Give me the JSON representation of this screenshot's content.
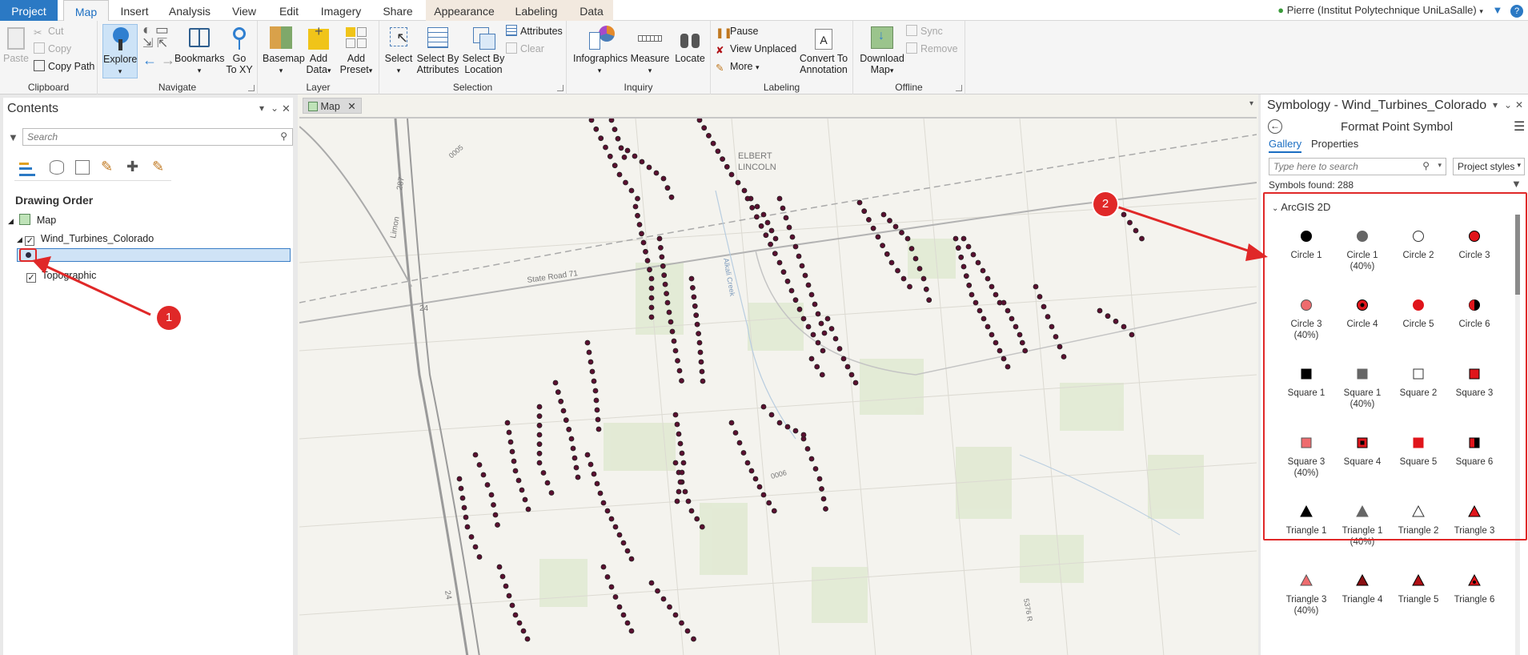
{
  "tabs": {
    "project": "Project",
    "map": "Map",
    "insert": "Insert",
    "analysis": "Analysis",
    "view": "View",
    "edit": "Edit",
    "imagery": "Imagery",
    "share": "Share",
    "appearance": "Appearance",
    "labeling": "Labeling",
    "data": "Data"
  },
  "user": "Pierre (Institut Polytechnique UniLaSalle)",
  "ribbon": {
    "clipboard": {
      "label": "Clipboard",
      "paste": "Paste",
      "cut": "Cut",
      "copy": "Copy",
      "copy_path": "Copy Path"
    },
    "navigate": {
      "label": "Navigate",
      "explore": "Explore",
      "bookmarks": "Bookmarks",
      "goto": "Go",
      "goto2": "To XY"
    },
    "layer": {
      "label": "Layer",
      "basemap": "Basemap",
      "add_data": "Add",
      "add_data2": "Data",
      "add_preset": "Add",
      "add_preset2": "Preset"
    },
    "selection": {
      "label": "Selection",
      "select": "Select",
      "sel_attr": "Select By",
      "sel_attr2": "Attributes",
      "sel_loc": "Select By",
      "sel_loc2": "Location",
      "attributes": "Attributes",
      "clear": "Clear"
    },
    "inquiry": {
      "label": "Inquiry",
      "infographics": "Infographics",
      "measure": "Measure",
      "locate": "Locate"
    },
    "labeling": {
      "label": "Labeling",
      "pause": "Pause",
      "view_unplaced": "View Unplaced",
      "more": "More",
      "convert": "Convert To",
      "convert2": "Annotation"
    },
    "offline": {
      "label": "Offline",
      "download": "Download",
      "download2": "Map",
      "sync": "Sync",
      "remove": "Remove"
    }
  },
  "contents": {
    "title": "Contents",
    "search_placeholder": "Search",
    "drawing_order": "Drawing Order",
    "map_name": "Map",
    "layer1": "Wind_Turbines_Colorado",
    "layer2": "Topographic"
  },
  "map": {
    "tab": "Map",
    "labels": {
      "elbert": "ELBERT",
      "lincoln": "LINCOLN",
      "state_road": "State Road 71",
      "limon": "Limon",
      "road287": "287",
      "road24": "24",
      "road0005": "0005",
      "road0006": "0006",
      "road24b": "24",
      "road5376": "5376 R",
      "alkali": "Alkali Creek"
    }
  },
  "symbology": {
    "title": "Symbology - Wind_Turbines_Colorado",
    "subtitle": "Format Point Symbol",
    "tab_gallery": "Gallery",
    "tab_properties": "Properties",
    "search_placeholder": "Type here to search",
    "styles": "Project styles",
    "found": "Symbols found: 288",
    "category": "ArcGIS 2D",
    "items": [
      {
        "name": "Circle 1",
        "sub": "",
        "shape": "circle",
        "fill": "#000000",
        "stroke": "#000000"
      },
      {
        "name": "Circle 1",
        "sub": "(40%)",
        "shape": "circle",
        "fill": "#666666",
        "stroke": "#666666"
      },
      {
        "name": "Circle 2",
        "sub": "",
        "shape": "circle",
        "fill": "#ffffff",
        "stroke": "#333333"
      },
      {
        "name": "Circle 3",
        "sub": "",
        "shape": "circle",
        "fill": "#e0151b",
        "stroke": "#000000"
      },
      {
        "name": "Circle 3",
        "sub": "(40%)",
        "shape": "circle",
        "fill": "#ee6b6e",
        "stroke": "#555555"
      },
      {
        "name": "Circle 4",
        "sub": "",
        "shape": "circle-dot",
        "fill": "#e0151b",
        "stroke": "#000000"
      },
      {
        "name": "Circle 5",
        "sub": "",
        "shape": "circle",
        "fill": "#e0151b",
        "stroke": "#e0151b"
      },
      {
        "name": "Circle 6",
        "sub": "",
        "shape": "circle-half",
        "fill": "#e0151b",
        "stroke": "#000000"
      },
      {
        "name": "Square 1",
        "sub": "",
        "shape": "square",
        "fill": "#000000",
        "stroke": "#000000"
      },
      {
        "name": "Square 1",
        "sub": "(40%)",
        "shape": "square",
        "fill": "#666666",
        "stroke": "#666666"
      },
      {
        "name": "Square 2",
        "sub": "",
        "shape": "square",
        "fill": "#ffffff",
        "stroke": "#333333"
      },
      {
        "name": "Square 3",
        "sub": "",
        "shape": "square",
        "fill": "#e0151b",
        "stroke": "#000000"
      },
      {
        "name": "Square 3",
        "sub": "(40%)",
        "shape": "square",
        "fill": "#ee6b6e",
        "stroke": "#555555"
      },
      {
        "name": "Square 4",
        "sub": "",
        "shape": "square-dot",
        "fill": "#e0151b",
        "stroke": "#000000"
      },
      {
        "name": "Square 5",
        "sub": "",
        "shape": "square",
        "fill": "#e0151b",
        "stroke": "#e0151b"
      },
      {
        "name": "Square 6",
        "sub": "",
        "shape": "square-half",
        "fill": "#e0151b",
        "stroke": "#000000"
      },
      {
        "name": "Triangle 1",
        "sub": "",
        "shape": "triangle",
        "fill": "#000000",
        "stroke": "#000000"
      },
      {
        "name": "Triangle 1",
        "sub": "(40%)",
        "shape": "triangle",
        "fill": "#666666",
        "stroke": "#666666"
      },
      {
        "name": "Triangle 2",
        "sub": "",
        "shape": "triangle",
        "fill": "#ffffff",
        "stroke": "#333333"
      },
      {
        "name": "Triangle 3",
        "sub": "",
        "shape": "triangle",
        "fill": "#e0151b",
        "stroke": "#000000"
      },
      {
        "name": "Triangle 3",
        "sub": "(40%)",
        "shape": "triangle",
        "fill": "#ee6b6e",
        "stroke": "#555555"
      },
      {
        "name": "Triangle 4",
        "sub": "",
        "shape": "triangle",
        "fill": "#8a0f12",
        "stroke": "#000000"
      },
      {
        "name": "Triangle 5",
        "sub": "",
        "shape": "triangle",
        "fill": "#b01015",
        "stroke": "#000000"
      },
      {
        "name": "Triangle 6",
        "sub": "",
        "shape": "triangle-dot",
        "fill": "#e0151b",
        "stroke": "#000000"
      }
    ]
  },
  "callouts": {
    "one": "1",
    "two": "2"
  },
  "colors": {
    "accent": "#2b79c4",
    "annotation": "#e02828",
    "turbine": "#5a1030"
  }
}
